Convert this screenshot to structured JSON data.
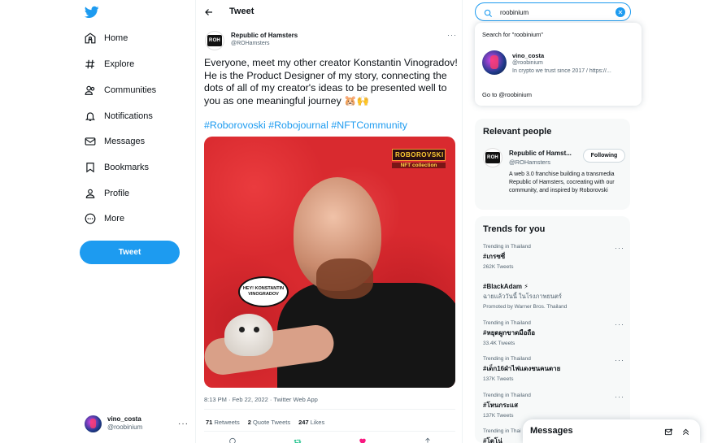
{
  "nav": {
    "items": [
      {
        "label": "Home",
        "icon": "home-icon"
      },
      {
        "label": "Explore",
        "icon": "hashtag-icon"
      },
      {
        "label": "Communities",
        "icon": "communities-icon"
      },
      {
        "label": "Notifications",
        "icon": "bell-icon"
      },
      {
        "label": "Messages",
        "icon": "envelope-icon"
      },
      {
        "label": "Bookmarks",
        "icon": "bookmark-icon"
      },
      {
        "label": "Profile",
        "icon": "person-icon"
      },
      {
        "label": "More",
        "icon": "more-circle-icon"
      }
    ],
    "tweet_button": "Tweet",
    "account": {
      "name": "vino_costa",
      "handle": "@roobinium",
      "more": "···"
    }
  },
  "main": {
    "header_title": "Tweet",
    "author": {
      "name": "Republic of Hamsters",
      "handle": "@ROHamsters",
      "avatar_text": "ROH"
    },
    "more": "···",
    "text": "Everyone, meet my other creator Konstantin Vinogradov! He is the Product Designer of my story, connecting the dots of all of my creator's ideas to be presented well to you as one meaningful journey 🐹🙌",
    "hashtags": "#Roborovoski #Robojournal #NFTCommunity",
    "image": {
      "logo_line1": "ROBOROVSKI",
      "logo_line2": "NFT collection",
      "speech": "HEY! KONSTANTIN VINOGRADOV"
    },
    "meta": "8:13 PM · Feb 22, 2022 · Twitter Web App",
    "stats": [
      {
        "count": "71",
        "label": "Retweets"
      },
      {
        "count": "2",
        "label": "Quote Tweets"
      },
      {
        "count": "247",
        "label": "Likes"
      }
    ]
  },
  "search": {
    "value": "roobinium",
    "search_for": "Search for \"roobinium\"",
    "result": {
      "name": "vino_costa",
      "handle": "@roobinium",
      "bio": "In crypto we trust since 2017 / https://..."
    },
    "goto": "Go to @roobinium"
  },
  "relevant": {
    "title": "Relevant people",
    "user": {
      "name": "Republic of Hamst...",
      "handle": "@ROHamsters",
      "follow_label": "Following",
      "bio": "A web 3.0 franchise building a transmedia Republic of Hamsters, cocreating with our community, and inspired by Roborovski"
    }
  },
  "trends": {
    "title": "Trends for you",
    "items": [
      {
        "context": "Trending in Thailand",
        "name": "#เกรซซี่",
        "count": "262K Tweets"
      },
      {
        "context": "",
        "name": "#BlackAdam ⚡",
        "description": "ฉายแล้ววันนี้ ในโรงภาพยนตร์",
        "count": "Promoted by Warner Bros. Thailand"
      },
      {
        "context": "Trending in Thailand",
        "name": "#หยุดผูกขาดมือถือ",
        "count": "33.4K Tweets"
      },
      {
        "context": "Trending in Thailand",
        "name": "#เด็ก16ฝ่าไฟแดงชนคนตาย",
        "count": "137K Tweets"
      },
      {
        "context": "Trending in Thailand",
        "name": "#โหนกระแส",
        "count": "137K Tweets"
      },
      {
        "context": "Trending in Thai",
        "name": "#โตโน่",
        "count": ""
      }
    ],
    "more": "···"
  },
  "messages_bar": {
    "title": "Messages"
  },
  "colors": {
    "accent": "#1d9bf0",
    "text": "#0f1419",
    "muted": "#536471",
    "panel": "#f7f9f9"
  }
}
